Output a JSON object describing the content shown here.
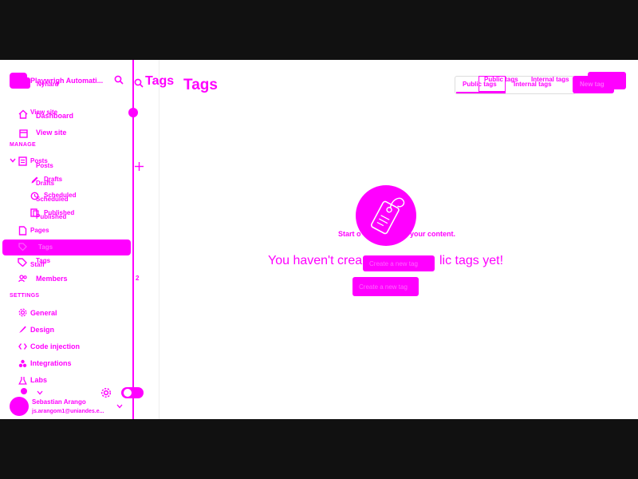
{
  "brand": {
    "name": "Playwrigh Automati...",
    "overlay_label": "Nyhard"
  },
  "sidebar": {
    "view_site_short": "View site",
    "dashboard": "Dashboard",
    "view_site": "View site",
    "manage_heading": "MANAGE",
    "posts": "Posts",
    "posts_overlay": "Posts",
    "drafts": "Drafts",
    "drafts_overlay": "Drafts",
    "scheduled": "Scheduled",
    "scheduled_overlay": "Scheduled",
    "published": "Published",
    "published_overlay": "Published",
    "pages": "Pages",
    "tags_highlight": "Tags",
    "tags": "Tags",
    "staff": "Staff",
    "members": "Members",
    "members_count": "2",
    "settings_heading": "SETTINGS",
    "general": "General",
    "design": "Design",
    "code_injection": "Code injection",
    "integrations": "Integrations",
    "labs": "Labs"
  },
  "user": {
    "name": "Sebastian Arango",
    "email": "js.arangom1@uniandes.e..."
  },
  "mid_panel": {
    "title": "Tags"
  },
  "header": {
    "title": "Tags",
    "public_tags": "Public tags",
    "public_tags_overlay": "Public tags",
    "internal_tags": "Internal tags",
    "internal_tags_overlay": "Internal tags",
    "new_tag": "New tag"
  },
  "empty_state": {
    "subtitle_left": "Start o",
    "subtitle_right": "your content.",
    "headline_left": "You haven't crea",
    "headline_overlay": "Create a new tag",
    "headline_right": "lic tags yet!",
    "button": "Create a new tag"
  },
  "colors": {
    "accent": "#ff00ff",
    "frame": "#111111",
    "background": "#ffffff"
  }
}
